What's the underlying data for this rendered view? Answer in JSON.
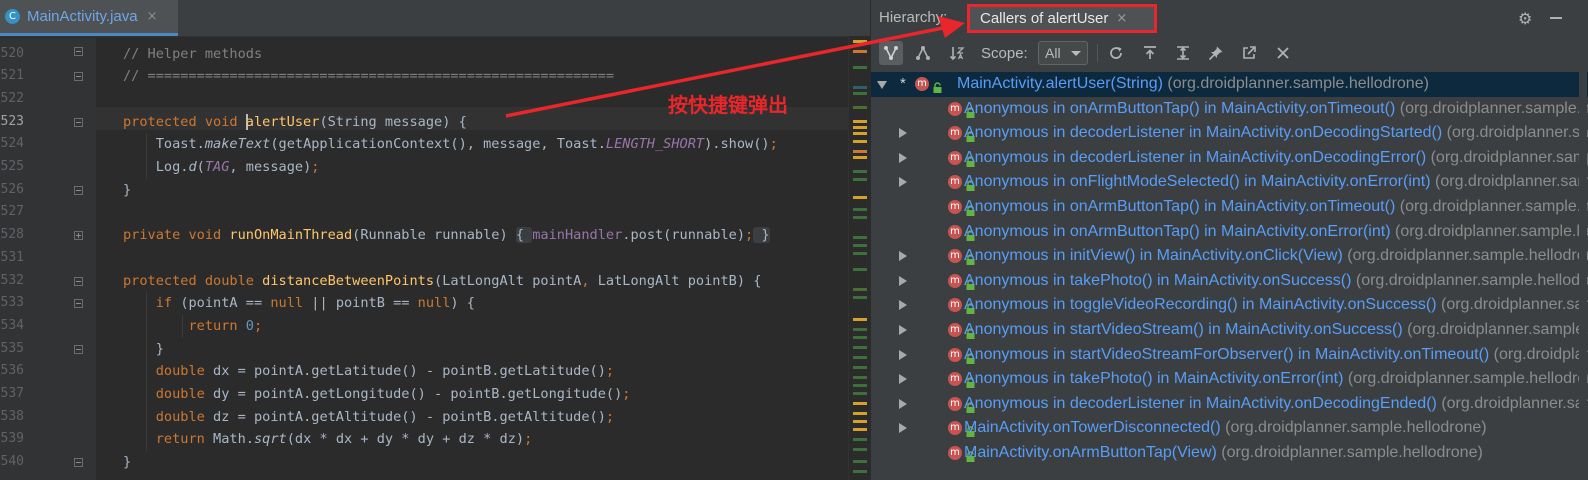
{
  "editor": {
    "tab": {
      "icon_letter": "C",
      "file_name": "MainActivity.java",
      "close": "×"
    },
    "current_line": "523",
    "lines": [
      {
        "num": "520",
        "parts": [
          {
            "t": "// Helper methods",
            "c": "cm"
          }
        ]
      },
      {
        "num": "521",
        "parts": [
          {
            "t": "// =========================================================",
            "c": "cm"
          }
        ]
      },
      {
        "num": "522",
        "parts": []
      },
      {
        "num": "523",
        "parts": [
          {
            "t": "protected void ",
            "c": "kw"
          },
          {
            "t": "",
            "c": "caret"
          },
          {
            "t": "alertUser",
            "c": "fn"
          },
          {
            "t": "(String message) {",
            "c": ""
          }
        ]
      },
      {
        "num": "524",
        "parts": [
          {
            "t": "    Toast.",
            "c": ""
          },
          {
            "t": "makeText",
            "c": "it"
          },
          {
            "t": "(getApplicationContext(), message, Toast.",
            "c": ""
          },
          {
            "t": "LENGTH_SHORT",
            "c": "itf"
          },
          {
            "t": ").show()",
            "c": ""
          },
          {
            "t": ";",
            "c": "kw"
          }
        ]
      },
      {
        "num": "525",
        "parts": [
          {
            "t": "    Log.",
            "c": ""
          },
          {
            "t": "d",
            "c": "it"
          },
          {
            "t": "(",
            "c": ""
          },
          {
            "t": "TAG",
            "c": "itf"
          },
          {
            "t": ", message)",
            "c": ""
          },
          {
            "t": ";",
            "c": "kw"
          }
        ]
      },
      {
        "num": "526",
        "parts": [
          {
            "t": "}",
            "c": ""
          }
        ]
      },
      {
        "num": "527",
        "parts": []
      },
      {
        "num": "528",
        "parts": [
          {
            "t": "private void ",
            "c": "kw"
          },
          {
            "t": "runOnMainThread",
            "c": "fn"
          },
          {
            "t": "(Runnable runnable) ",
            "c": ""
          },
          {
            "t": "{ ",
            "c": "fbox"
          },
          {
            "t": "mainHandler",
            "c": "fld"
          },
          {
            "t": ".post(runnable)",
            "c": ""
          },
          {
            "t": ";",
            "c": "kw"
          },
          {
            "t": " }",
            "c": "fbox"
          }
        ]
      },
      {
        "num": "531",
        "parts": []
      },
      {
        "num": "532",
        "parts": [
          {
            "t": "protected double ",
            "c": "kw"
          },
          {
            "t": "distanceBetweenPoints",
            "c": "fn"
          },
          {
            "t": "(LatLongAlt pointA",
            "c": ""
          },
          {
            "t": ", ",
            "c": "kw"
          },
          {
            "t": "LatLongAlt pointB) {",
            "c": ""
          }
        ]
      },
      {
        "num": "533",
        "parts": [
          {
            "t": "    ",
            "c": ""
          },
          {
            "t": "if ",
            "c": "kw"
          },
          {
            "t": "(pointA == ",
            "c": ""
          },
          {
            "t": "null ",
            "c": "kw"
          },
          {
            "t": "|| pointB == ",
            "c": ""
          },
          {
            "t": "null",
            "c": "kw"
          },
          {
            "t": ") {",
            "c": ""
          }
        ]
      },
      {
        "num": "534",
        "parts": [
          {
            "t": "        ",
            "c": ""
          },
          {
            "t": "return ",
            "c": "kw"
          },
          {
            "t": "0",
            "c": "num"
          },
          {
            "t": ";",
            "c": "kw"
          }
        ]
      },
      {
        "num": "535",
        "parts": [
          {
            "t": "    }",
            "c": ""
          }
        ]
      },
      {
        "num": "536",
        "parts": [
          {
            "t": "    ",
            "c": ""
          },
          {
            "t": "double ",
            "c": "kw"
          },
          {
            "t": "dx = pointA.getLatitude() - pointB.getLatitude()",
            "c": ""
          },
          {
            "t": ";",
            "c": "kw"
          }
        ]
      },
      {
        "num": "537",
        "parts": [
          {
            "t": "    ",
            "c": ""
          },
          {
            "t": "double ",
            "c": "kw"
          },
          {
            "t": "dy = pointA.getLongitude() - pointB.getLongitude()",
            "c": ""
          },
          {
            "t": ";",
            "c": "kw"
          }
        ]
      },
      {
        "num": "538",
        "parts": [
          {
            "t": "    ",
            "c": ""
          },
          {
            "t": "double ",
            "c": "kw"
          },
          {
            "t": "dz = pointA.getAltitude() - pointB.getAltitude()",
            "c": ""
          },
          {
            "t": ";",
            "c": "kw"
          }
        ]
      },
      {
        "num": "539",
        "parts": [
          {
            "t": "    ",
            "c": ""
          },
          {
            "t": "return ",
            "c": "kw"
          },
          {
            "t": "Math.",
            "c": ""
          },
          {
            "t": "sqrt",
            "c": "it"
          },
          {
            "t": "(dx * dx + dy * dy + dz * dz)",
            "c": ""
          },
          {
            "t": ";",
            "c": "kw"
          }
        ]
      },
      {
        "num": "540",
        "parts": [
          {
            "t": "}",
            "c": ""
          }
        ]
      }
    ]
  },
  "hierarchy": {
    "label": "Hierarchy:",
    "tab_label": "Callers of alertUser",
    "tab_close": "×",
    "scope_label": "Scope:",
    "scope_value": "All",
    "toolbar_icons": [
      "caller-hierarchy-icon",
      "callee-hierarchy-icon",
      "sort-alphabetically-icon",
      "refresh-icon",
      "export-icon",
      "expand-all-icon",
      "pin-icon",
      "open-in-new-window-icon",
      "close-icon"
    ],
    "root": {
      "text": "MainActivity.alertUser(String)",
      "pkg": "(org.droidplanner.sample.hellodrone)",
      "star": "*",
      "icon": "m"
    },
    "items": [
      {
        "text": "Anonymous in onArmButtonTap() in MainActivity.onTimeout()",
        "pkg": "(org.droidplanner.sample.hellodrone)",
        "expandable": false
      },
      {
        "text": "Anonymous in decoderListener in MainActivity.onDecodingStarted()",
        "pkg": "(org.droidplanner.sample.hellodrone)",
        "expandable": true
      },
      {
        "text": "Anonymous in decoderListener in MainActivity.onDecodingError()",
        "pkg": "(org.droidplanner.sample.hellodrone)",
        "expandable": true
      },
      {
        "text": "Anonymous in onFlightModeSelected() in MainActivity.onError(int)",
        "pkg": "(org.droidplanner.sample.hellodrone)",
        "expandable": true
      },
      {
        "text": "Anonymous in onArmButtonTap() in MainActivity.onTimeout()",
        "pkg": "(org.droidplanner.sample.hellodrone)",
        "expandable": false
      },
      {
        "text": "Anonymous in onArmButtonTap() in MainActivity.onError(int)",
        "pkg": "(org.droidplanner.sample.hellodrone)",
        "expandable": false
      },
      {
        "text": "Anonymous in initView() in MainActivity.onClick(View)",
        "pkg": "(org.droidplanner.sample.hellodrone)",
        "expandable": true
      },
      {
        "text": "Anonymous in takePhoto() in MainActivity.onSuccess()",
        "pkg": "(org.droidplanner.sample.hellodrone)",
        "expandable": true
      },
      {
        "text": "Anonymous in toggleVideoRecording() in MainActivity.onSuccess()",
        "pkg": "(org.droidplanner.sample.hellodrone)",
        "expandable": true
      },
      {
        "text": "Anonymous in startVideoStream() in MainActivity.onSuccess()",
        "pkg": "(org.droidplanner.sample.hellodrone)",
        "expandable": true
      },
      {
        "text": "Anonymous in startVideoStreamForObserver() in MainActivity.onTimeout()",
        "pkg": "(org.droidplanner.sample.hellodrone)",
        "expandable": true
      },
      {
        "text": "Anonymous in takePhoto() in MainActivity.onError(int)",
        "pkg": "(org.droidplanner.sample.hellodrone)",
        "expandable": true
      },
      {
        "text": "Anonymous in decoderListener in MainActivity.onDecodingEnded()",
        "pkg": "(org.droidplanner.sample.hellodrone)",
        "expandable": true
      },
      {
        "text": "MainActivity.onTowerDisconnected()",
        "pkg": "(org.droidplanner.sample.hellodrone)",
        "expandable": true
      },
      {
        "text": "MainActivity.onArmButtonTap(View)",
        "pkg": "(org.droidplanner.sample.hellodrone)",
        "expandable": false
      }
    ]
  },
  "annotation": {
    "text": "按快捷键弹出",
    "color": "#e8262b"
  },
  "colors": {
    "selection": "#0d293e",
    "link": "#589df6",
    "keyword": "#cc7832",
    "method": "#ffc66d"
  }
}
